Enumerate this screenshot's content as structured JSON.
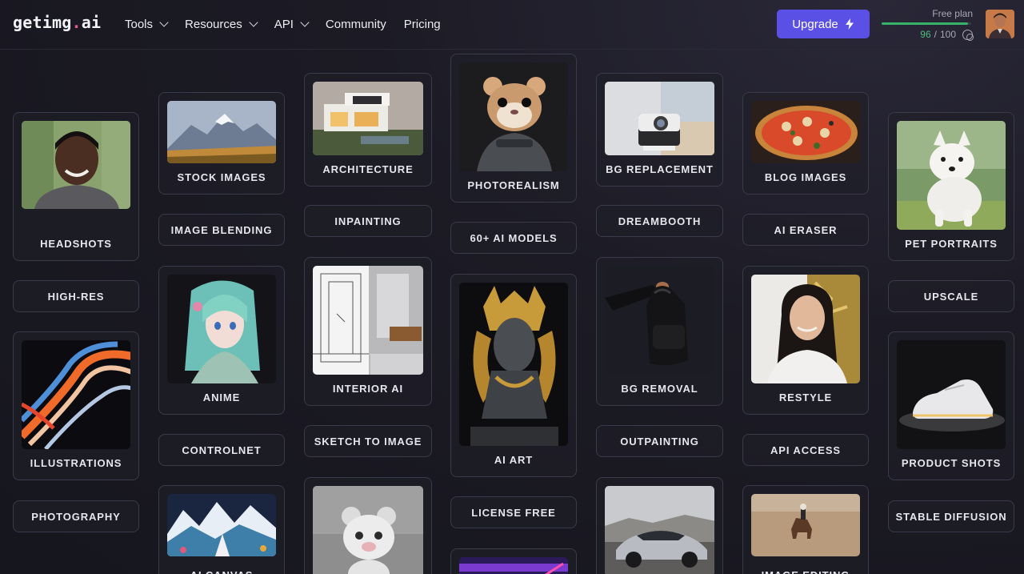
{
  "logo": {
    "prefix": "getimg",
    "dot": ".",
    "suffix": "ai"
  },
  "nav": [
    {
      "label": "Tools",
      "dropdown": true
    },
    {
      "label": "Resources",
      "dropdown": true
    },
    {
      "label": "API",
      "dropdown": true
    },
    {
      "label": "Community",
      "dropdown": false
    },
    {
      "label": "Pricing",
      "dropdown": false
    }
  ],
  "upgrade": {
    "label": "Upgrade",
    "icon": "lightning-icon"
  },
  "plan": {
    "label": "Free plan",
    "used": "96",
    "separator": "/",
    "total": "100",
    "progress": 0.96
  },
  "cards": {
    "headshots": "HEADSHOTS",
    "stock_images": "STOCK IMAGES",
    "architecture": "ARCHITECTURE",
    "photorealism": "PHOTOREALISM",
    "bg_replacement": "BG REPLACEMENT",
    "blog_images": "BLOG IMAGES",
    "pet_portraits": "PET PORTRAITS",
    "anime": "ANIME",
    "interior_ai": "INTERIOR AI",
    "ai_art": "AI ART",
    "bg_removal": "BG REMOVAL",
    "restyle": "RESTYLE",
    "illustrations": "ILLUSTRATIONS",
    "product_shots": "PRODUCT SHOTS",
    "ai_canvas": "AI CANVAS",
    "image_editing": "IMAGE EDITING"
  },
  "pills": {
    "image_blending": "IMAGE BLENDING",
    "inpainting": "INPAINTING",
    "ai_models": "60+ AI MODELS",
    "dreambooth": "DREAMBOOTH",
    "ai_eraser": "AI ERASER",
    "high_res": "HIGH-RES",
    "upscale": "UPSCALE",
    "controlnet": "CONTROLNET",
    "sketch_to_image": "SKETCH TO IMAGE",
    "outpainting": "OUTPAINTING",
    "api_access": "API ACCESS",
    "photography": "PHOTOGRAPHY",
    "license_free": "LICENSE FREE",
    "stable_diffusion": "STABLE DIFFUSION"
  },
  "colors": {
    "accent": "#5b50e6",
    "progress": "#37b26a",
    "logo_dot": "#e25c8a"
  }
}
